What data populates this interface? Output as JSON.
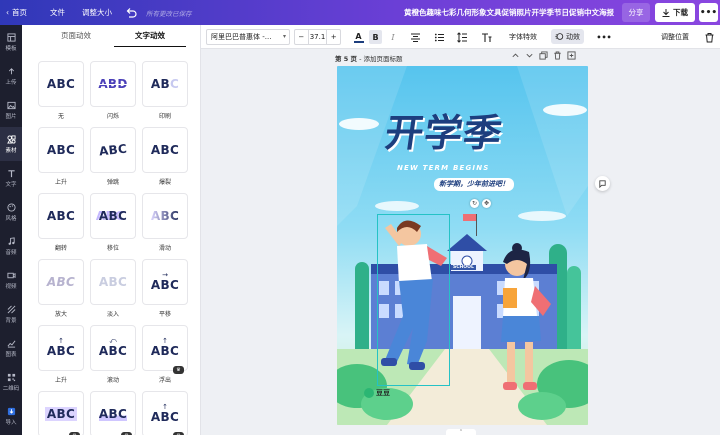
{
  "topbar": {
    "home": "首页",
    "file": "文件",
    "resize": "调整大小",
    "save_status": "所有更改已保存",
    "doc_title": "黄橙色趣味七彩几何形象文具促销照片开学季节日促销中文海报",
    "share": "分享",
    "download": "下载",
    "more": "•••"
  },
  "leftnav": [
    {
      "label": "模板",
      "icon": "template-icon"
    },
    {
      "label": "上传",
      "icon": "upload-icon"
    },
    {
      "label": "图片",
      "icon": "image-icon"
    },
    {
      "label": "素材",
      "icon": "elements-icon"
    },
    {
      "label": "文字",
      "icon": "text-icon"
    },
    {
      "label": "风格",
      "icon": "palette-icon"
    },
    {
      "label": "音频",
      "icon": "audio-icon"
    },
    {
      "label": "视频",
      "icon": "video-icon"
    },
    {
      "label": "背景",
      "icon": "background-icon"
    },
    {
      "label": "图表",
      "icon": "chart-icon"
    },
    {
      "label": "二维码",
      "icon": "qrcode-icon"
    },
    {
      "label": "导入",
      "icon": "import-icon"
    }
  ],
  "panel": {
    "tabs": [
      "页面动效",
      "文字动效"
    ],
    "animations": [
      {
        "label": "无",
        "preview": "ABC"
      },
      {
        "label": "闪烁",
        "preview": "ABD"
      },
      {
        "label": "印刷",
        "preview": "ABC"
      },
      {
        "label": "上升",
        "preview": "ABC"
      },
      {
        "label": "弹跳",
        "preview": "ABC"
      },
      {
        "label": "爆裂",
        "preview": "ABC"
      },
      {
        "label": "翻转",
        "preview": "ABC"
      },
      {
        "label": "移位",
        "preview": "ABC"
      },
      {
        "label": "滑动",
        "preview": "ABC"
      },
      {
        "label": "放大",
        "preview": "ABC"
      },
      {
        "label": "淡入",
        "preview": "ABC"
      },
      {
        "label": "平移",
        "preview": "ABC"
      },
      {
        "label": "上升",
        "preview": "ABC"
      },
      {
        "label": "滚动",
        "preview": "ABC"
      },
      {
        "label": "浮出",
        "preview": "ABC"
      },
      {
        "label": "",
        "preview": "ABC"
      },
      {
        "label": "",
        "preview": "ABC"
      },
      {
        "label": "",
        "preview": "ABC"
      }
    ]
  },
  "toolbar": {
    "font_name": "阿里巴巴普惠体 -...",
    "font_size": "37.1",
    "minus": "−",
    "plus": "+",
    "bold": "B",
    "italic": "I",
    "text_effects": "字体特效",
    "animate": "动效",
    "more": "•••",
    "adjust_position": "调整位置"
  },
  "canvas": {
    "page_label": "第 5 页",
    "page_title_hint": "- 添加页面标题",
    "poster": {
      "title": "开学季",
      "subtitle": "NEW TERM BEGINS",
      "slogan": "新学期，少年前进吧！",
      "school_sign": "SCHOOL",
      "brand": "豆豆"
    }
  },
  "colors": {
    "topbar_start": "#2f38b8",
    "topbar_end": "#8a46e0",
    "nav_bg": "#1d1f2e",
    "selection": "#25c2c6",
    "title_blue": "#1d3e7e"
  }
}
